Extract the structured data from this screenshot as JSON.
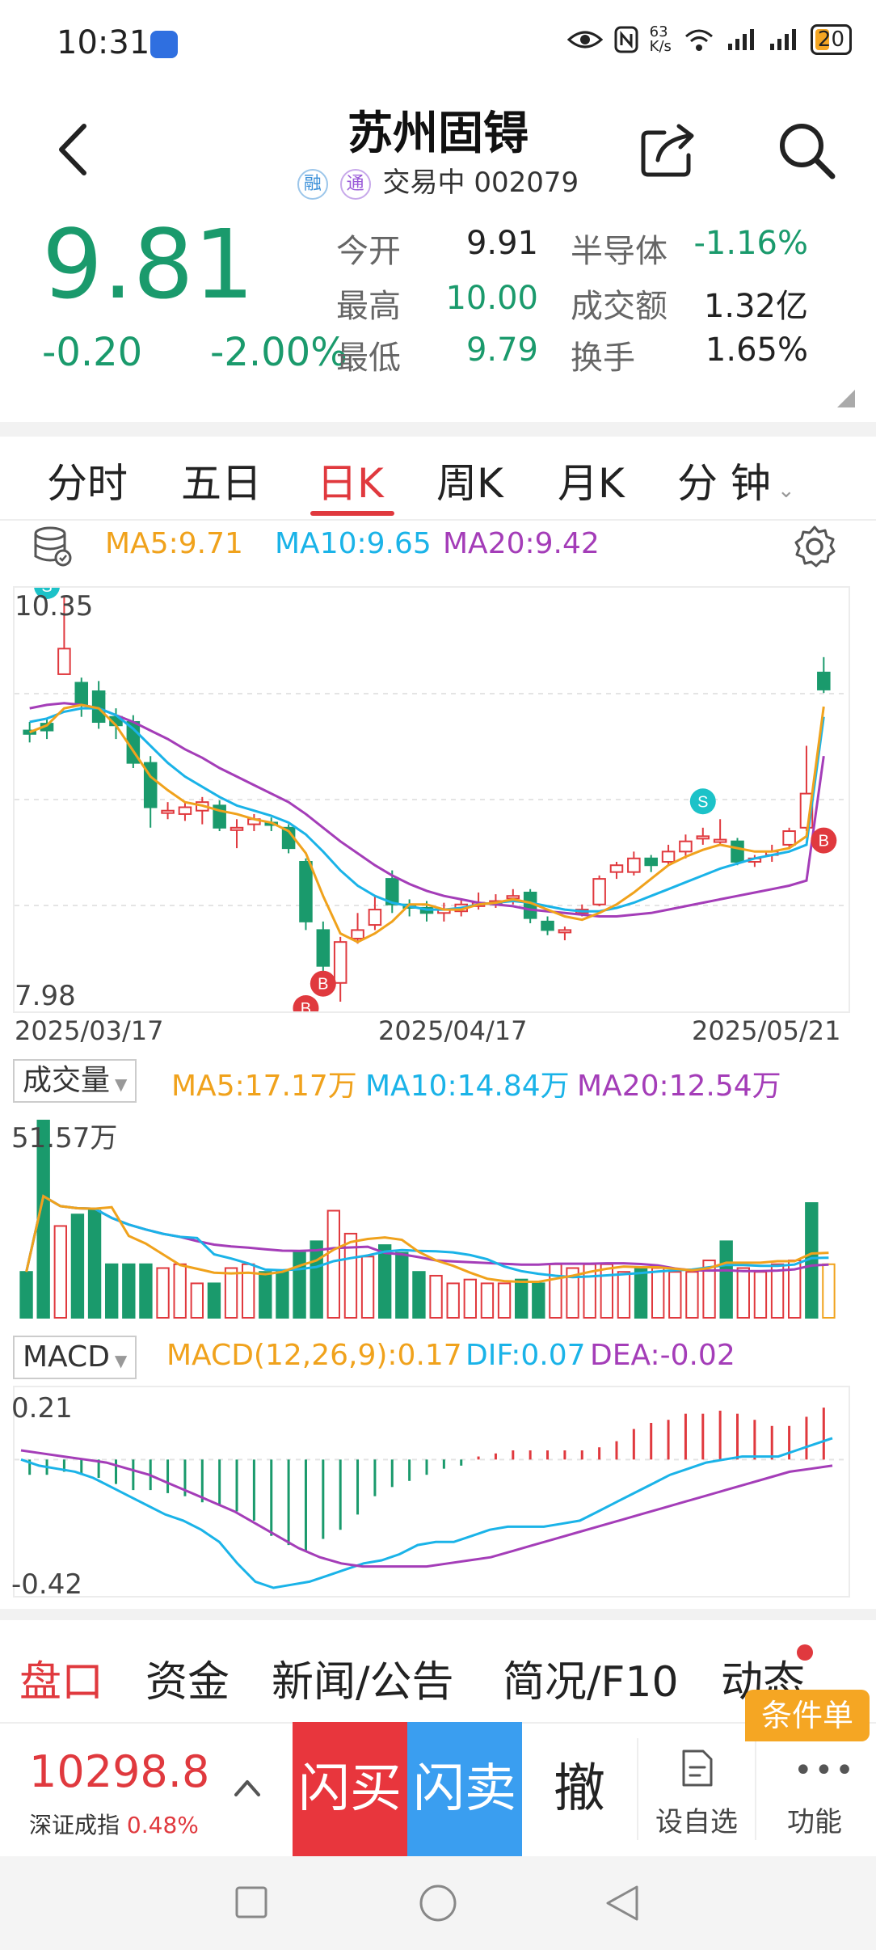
{
  "status_bar": {
    "time": "10:31",
    "net_speed_top": "63",
    "net_speed_bottom": "K/s",
    "battery": "20",
    "icons": [
      "app-icon",
      "eye-icon",
      "nfc-icon",
      "wifi-icon",
      "signal-icon",
      "signal-icon",
      "battery-icon"
    ]
  },
  "header": {
    "title": "苏州固锝",
    "badge1": "融",
    "badge2": "通",
    "status": "交易中",
    "code": "002079"
  },
  "quote": {
    "price": "9.81",
    "change": "-0.20",
    "change_pct": "-2.00%",
    "open_label": "今开",
    "open": "9.91",
    "high_label": "最高",
    "high": "10.00",
    "low_label": "最低",
    "low": "9.79",
    "sector_label": "半导体",
    "sector_chg": "-1.16%",
    "amount_label": "成交额",
    "amount": "1.32亿",
    "turnover_label": "换手",
    "turnover": "1.65%"
  },
  "kline_tabs": [
    "分时",
    "五日",
    "日K",
    "周K",
    "月K",
    "分 钟"
  ],
  "active_tab": "日K",
  "ma": {
    "ma5": "MA5:9.71",
    "ma10": "MA10:9.65",
    "ma20": "MA20:9.42"
  },
  "price_chart": {
    "y_max_label": "10.35",
    "y_min_label": "7.98",
    "dates": [
      "2025/03/17",
      "2025/04/17",
      "2025/05/21"
    ],
    "marker_s": "S",
    "marker_b": "B"
  },
  "volume": {
    "selector": "成交量",
    "ma5": "MA5:17.17万",
    "ma10": "MA10:14.84万",
    "ma20": "MA20:12.54万",
    "max_label": "51.57万"
  },
  "macd": {
    "selector": "MACD",
    "macd": "MACD(12,26,9):0.17",
    "dif": "DIF:0.07",
    "dea": "DEA:-0.02",
    "top_label": "0.21",
    "bottom_label": "-0.42"
  },
  "bottom_tabs": [
    "盘口",
    "资金",
    "新闻/公告",
    "简况/F10",
    "动态"
  ],
  "order_tag": "条件单",
  "index": {
    "value": "10298.8",
    "name": "深证成指",
    "pct": "0.48%"
  },
  "actions": {
    "buy": "闪买",
    "sell": "闪卖",
    "cancel": "撤",
    "watch": "设自选",
    "more": "功能"
  },
  "colors": {
    "up": "#e0393e",
    "down": "#1a9a6c",
    "ma5": "#f0a21c",
    "ma10": "#1ab3e8",
    "ma20": "#a43db8"
  },
  "chart_data": {
    "type": "candlestick",
    "candles": [
      [
        9.57,
        9.55,
        9.62,
        9.5
      ],
      [
        9.61,
        9.57,
        9.64,
        9.52
      ],
      [
        9.9,
        10.05,
        10.35,
        9.95
      ],
      [
        9.85,
        9.72,
        9.88,
        9.65
      ],
      [
        9.8,
        9.62,
        9.86,
        9.58
      ],
      [
        9.65,
        9.6,
        9.7,
        9.52
      ],
      [
        9.62,
        9.38,
        9.66,
        9.35
      ],
      [
        9.38,
        9.12,
        9.42,
        9.0
      ],
      [
        9.1,
        9.1,
        9.15,
        9.05
      ],
      [
        9.08,
        9.12,
        9.15,
        9.04
      ],
      [
        9.1,
        9.15,
        9.18,
        9.02
      ],
      [
        9.13,
        9.0,
        9.16,
        8.98
      ],
      [
        9.0,
        9.0,
        9.05,
        8.88
      ],
      [
        9.02,
        9.05,
        9.08,
        8.98
      ],
      [
        9.03,
        9.02,
        9.06,
        8.98
      ],
      [
        9.0,
        8.88,
        9.02,
        8.85
      ],
      [
        8.8,
        8.45,
        8.82,
        8.4
      ],
      [
        8.4,
        8.19,
        8.45,
        8.15
      ],
      [
        8.09,
        8.33,
        8.36,
        7.98
      ],
      [
        8.35,
        8.4,
        8.5,
        8.32
      ],
      [
        8.43,
        8.52,
        8.6,
        8.4
      ],
      [
        8.7,
        8.55,
        8.75,
        8.5
      ],
      [
        8.55,
        8.53,
        8.58,
        8.48
      ],
      [
        8.53,
        8.5,
        8.57,
        8.45
      ],
      [
        8.5,
        8.52,
        8.56,
        8.45
      ],
      [
        8.51,
        8.55,
        8.58,
        8.48
      ],
      [
        8.54,
        8.56,
        8.62,
        8.52
      ],
      [
        8.56,
        8.57,
        8.61,
        8.53
      ],
      [
        8.59,
        8.6,
        8.64,
        8.55
      ],
      [
        8.62,
        8.47,
        8.64,
        8.44
      ],
      [
        8.45,
        8.4,
        8.48,
        8.37
      ],
      [
        8.4,
        8.4,
        8.42,
        8.34
      ],
      [
        8.5,
        8.52,
        8.55,
        8.48
      ],
      [
        8.55,
        8.7,
        8.72,
        8.54
      ],
      [
        8.74,
        8.78,
        8.8,
        8.7
      ],
      [
        8.74,
        8.82,
        8.86,
        8.72
      ],
      [
        8.82,
        8.78,
        8.84,
        8.74
      ],
      [
        8.8,
        8.86,
        8.9,
        8.78
      ],
      [
        8.86,
        8.92,
        8.96,
        8.82
      ],
      [
        8.94,
        8.95,
        9.0,
        8.9
      ],
      [
        8.92,
        8.93,
        9.05,
        8.9
      ],
      [
        8.92,
        8.8,
        8.94,
        8.78
      ],
      [
        8.8,
        8.82,
        8.84,
        8.77
      ],
      [
        8.84,
        8.86,
        8.9,
        8.8
      ],
      [
        8.9,
        8.98,
        9.0,
        8.88
      ],
      [
        9.0,
        9.2,
        9.48,
        8.98
      ],
      [
        9.91,
        9.81,
        10.0,
        9.79
      ]
    ],
    "ma5": [
      9.56,
      9.6,
      9.7,
      9.72,
      9.7,
      9.6,
      9.45,
      9.3,
      9.22,
      9.15,
      9.13,
      9.1,
      9.08,
      9.05,
      9.03,
      8.98,
      8.85,
      8.6,
      8.38,
      8.33,
      8.38,
      8.45,
      8.55,
      8.55,
      8.52,
      8.52,
      8.55,
      8.56,
      8.58,
      8.56,
      8.52,
      8.48,
      8.46,
      8.5,
      8.55,
      8.62,
      8.7,
      8.78,
      8.83,
      8.87,
      8.9,
      8.88,
      8.86,
      8.86,
      8.88,
      8.95,
      9.71
    ],
    "ma10": [
      9.62,
      9.64,
      9.68,
      9.7,
      9.7,
      9.66,
      9.58,
      9.48,
      9.38,
      9.3,
      9.24,
      9.18,
      9.13,
      9.1,
      9.07,
      9.03,
      8.96,
      8.86,
      8.75,
      8.66,
      8.6,
      8.56,
      8.54,
      8.52,
      8.52,
      8.53,
      8.55,
      8.56,
      8.57,
      8.56,
      8.54,
      8.52,
      8.51,
      8.51,
      8.53,
      8.56,
      8.6,
      8.64,
      8.68,
      8.72,
      8.76,
      8.79,
      8.82,
      8.84,
      8.86,
      8.9,
      9.65
    ],
    "ma20": [
      9.7,
      9.72,
      9.73,
      9.72,
      9.7,
      9.66,
      9.62,
      9.57,
      9.52,
      9.46,
      9.41,
      9.35,
      9.3,
      9.25,
      9.2,
      9.15,
      9.08,
      9.0,
      8.92,
      8.85,
      8.78,
      8.72,
      8.67,
      8.63,
      8.6,
      8.58,
      8.56,
      8.55,
      8.54,
      8.52,
      8.51,
      8.5,
      8.49,
      8.48,
      8.48,
      8.49,
      8.5,
      8.52,
      8.54,
      8.56,
      8.58,
      8.6,
      8.62,
      8.64,
      8.66,
      8.69,
      9.42
    ],
    "volume": [
      12,
      51.57,
      24,
      27,
      28,
      14,
      14,
      14,
      13,
      14,
      9,
      9,
      13,
      14,
      12,
      12,
      17,
      20,
      28,
      22,
      16,
      19,
      17,
      12,
      11,
      9,
      10,
      9,
      9,
      10,
      9,
      14,
      13,
      14,
      14,
      12,
      13,
      13,
      12,
      12,
      15,
      20,
      13,
      12,
      14,
      15,
      30,
      14
    ],
    "macd": [
      -0.05,
      -0.05,
      -0.04,
      -0.05,
      -0.06,
      -0.08,
      -0.1,
      -0.1,
      -0.11,
      -0.12,
      -0.14,
      -0.15,
      -0.17,
      -0.2,
      -0.25,
      -0.28,
      -0.3,
      -0.26,
      -0.23,
      -0.18,
      -0.12,
      -0.09,
      -0.07,
      -0.05,
      -0.03,
      -0.02,
      0.01,
      0.02,
      0.03,
      0.03,
      0.03,
      0.03,
      0.03,
      0.04,
      0.06,
      0.1,
      0.12,
      0.13,
      0.15,
      0.15,
      0.16,
      0.15,
      0.13,
      0.11,
      0.11,
      0.14,
      0.17
    ],
    "dif": [
      0.0,
      -0.02,
      -0.03,
      -0.04,
      -0.06,
      -0.09,
      -0.12,
      -0.15,
      -0.18,
      -0.2,
      -0.23,
      -0.27,
      -0.34,
      -0.4,
      -0.42,
      -0.41,
      -0.4,
      -0.38,
      -0.36,
      -0.34,
      -0.33,
      -0.31,
      -0.28,
      -0.27,
      -0.27,
      -0.25,
      -0.23,
      -0.22,
      -0.22,
      -0.22,
      -0.21,
      -0.2,
      -0.17,
      -0.14,
      -0.11,
      -0.08,
      -0.05,
      -0.03,
      -0.01,
      0.0,
      0.01,
      0.01,
      0.01,
      0.03,
      0.05,
      0.07
    ],
    "dea": [
      0.03,
      0.02,
      0.01,
      0.0,
      -0.01,
      -0.03,
      -0.05,
      -0.08,
      -0.11,
      -0.14,
      -0.17,
      -0.21,
      -0.25,
      -0.29,
      -0.32,
      -0.34,
      -0.35,
      -0.35,
      -0.35,
      -0.35,
      -0.34,
      -0.33,
      -0.32,
      -0.3,
      -0.28,
      -0.26,
      -0.24,
      -0.22,
      -0.2,
      -0.18,
      -0.16,
      -0.14,
      -0.12,
      -0.1,
      -0.08,
      -0.06,
      -0.04,
      -0.03,
      -0.02
    ]
  }
}
